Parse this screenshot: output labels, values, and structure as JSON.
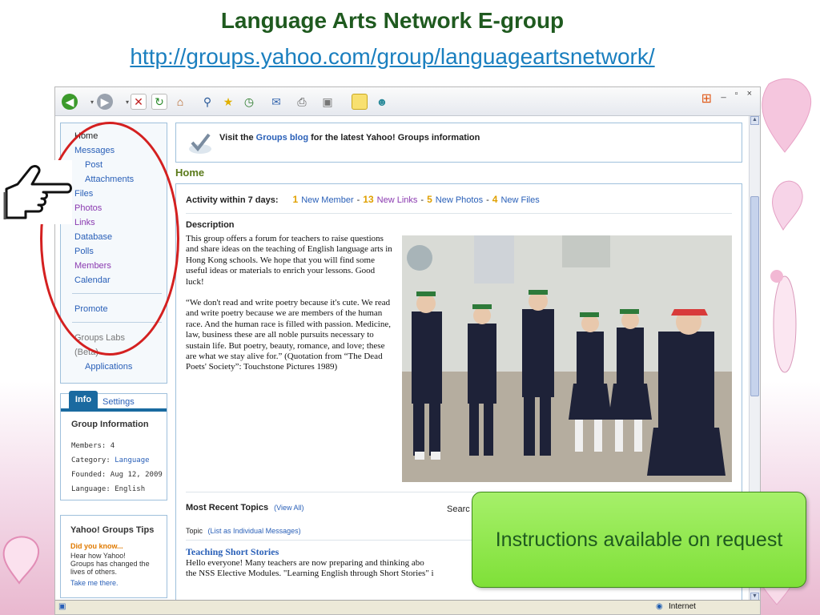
{
  "slide": {
    "title": "Language Arts Network E-group",
    "url": "http://groups.yahoo.com/group/languageartsnetwork/",
    "callout": "Instructions available on request"
  },
  "colors": {
    "title": "#1f5a1f",
    "url": "#1a7fbf",
    "callout_bg": "#8de84a",
    "ellipse": "#d42020"
  },
  "toolbar": {
    "icons": [
      "back-icon",
      "forward-icon",
      "stop-icon",
      "refresh-icon",
      "home-icon",
      "search-icon",
      "favorites-icon",
      "history-icon",
      "mail-icon",
      "print-icon",
      "edit-icon",
      "discuss-icon",
      "messenger-icon"
    ],
    "window_controls": "_ ▫ ×"
  },
  "nav": {
    "home": "Home",
    "messages": "Messages",
    "post": "Post",
    "attachments": "Attachments",
    "files": "Files",
    "photos": "Photos",
    "links": "Links",
    "database": "Database",
    "polls": "Polls",
    "members": "Members",
    "calendar": "Calendar",
    "promote": "Promote",
    "labs": "Groups Labs",
    "beta": "(Beta)",
    "applications": "Applications"
  },
  "info": {
    "tab_info": "Info",
    "tab_settings": "Settings",
    "heading": "Group Information",
    "members_label": "Members:",
    "members_value": "4",
    "category_label": "Category:",
    "category_value": "Language",
    "founded_label": "Founded:",
    "founded_value": "Aug 12, 2009",
    "language_label": "Language:",
    "language_value": "English"
  },
  "tips": {
    "heading": "Yahoo! Groups Tips",
    "did_you_know": "Did you know...",
    "text": "Hear how Yahoo! Groups has changed the lives of others.",
    "link": "Take me there."
  },
  "banner": {
    "prefix": "Visit the",
    "link": "Groups blog",
    "suffix": "for the latest Yahoo! Groups information"
  },
  "home_heading": "Home",
  "activity": {
    "label": "Activity within 7 days:",
    "n1": "1",
    "t1": "New Member",
    "n2": "13",
    "t2": "New Links",
    "n3": "5",
    "t3": "New Photos",
    "n4": "4",
    "t4": "New Files",
    "sep": "-"
  },
  "description": {
    "heading": "Description",
    "p1": "This group offers a forum for teachers to raise questions and share ideas on the teaching of English language arts in Hong Kong schools. We hope that you will find some useful ideas or materials to enrich your lessons. Good luck!",
    "p2": "“We don't read and write poetry because it's cute. We read and write poetry because we are members of the human race. And the human race is filled with passion. Medicine, law, business these are all noble pursuits necessary to sustain life. But poetry, beauty, romance, and love; these are what we stay alive for.” (Quotation from “The Dead Poets' Society”: Touchstone Pictures 1989)"
  },
  "topics": {
    "heading": "Most Recent Topics",
    "view_all": "(View All)",
    "search": "Searc",
    "topic_label": "Topic",
    "list_link": "(List as Individual Messages)",
    "topic1_title": "Teaching Short Stories",
    "topic1_line1": "Hello everyone! Many teachers are now preparing and thinking abo",
    "topic1_line2": "the NSS Elective Modules. \"Learning English through Short Stories\" i"
  },
  "status": {
    "zone": "Internet"
  }
}
